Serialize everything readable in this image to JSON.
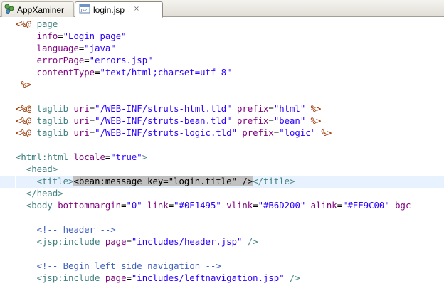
{
  "tabs": [
    {
      "label": "AppXaminer",
      "icon": "project-icon",
      "active": false
    },
    {
      "label": "login.jsp",
      "icon": "jsp-file-icon",
      "active": true,
      "close": "☒"
    }
  ],
  "code": {
    "current_line": 14,
    "lines": [
      [
        [
          "d",
          "<%@ "
        ],
        [
          "k",
          "page"
        ]
      ],
      [
        [
          "p",
          "    "
        ],
        [
          "a",
          "info"
        ],
        [
          "p",
          "="
        ],
        [
          "v",
          "\"Login page\""
        ]
      ],
      [
        [
          "p",
          "    "
        ],
        [
          "a",
          "language"
        ],
        [
          "p",
          "="
        ],
        [
          "v",
          "\"java\""
        ]
      ],
      [
        [
          "p",
          "    "
        ],
        [
          "a",
          "errorPage"
        ],
        [
          "p",
          "="
        ],
        [
          "v",
          "\"errors.jsp\""
        ]
      ],
      [
        [
          "p",
          "    "
        ],
        [
          "a",
          "contentType"
        ],
        [
          "p",
          "="
        ],
        [
          "v",
          "\"text/html;charset=utf-8\""
        ]
      ],
      [
        [
          "p",
          " "
        ],
        [
          "d",
          "%>"
        ]
      ],
      [
        [
          "p",
          ""
        ]
      ],
      [
        [
          "d",
          "<%@ "
        ],
        [
          "k",
          "taglib "
        ],
        [
          "a",
          "uri"
        ],
        [
          "p",
          "="
        ],
        [
          "v",
          "\"/WEB-INF/struts-html.tld\""
        ],
        [
          "p",
          " "
        ],
        [
          "a",
          "prefix"
        ],
        [
          "p",
          "="
        ],
        [
          "v",
          "\"html\""
        ],
        [
          "p",
          " "
        ],
        [
          "d",
          "%>"
        ]
      ],
      [
        [
          "d",
          "<%@ "
        ],
        [
          "k",
          "taglib "
        ],
        [
          "a",
          "uri"
        ],
        [
          "p",
          "="
        ],
        [
          "v",
          "\"/WEB-INF/struts-bean.tld\""
        ],
        [
          "p",
          " "
        ],
        [
          "a",
          "prefix"
        ],
        [
          "p",
          "="
        ],
        [
          "v",
          "\"bean\""
        ],
        [
          "p",
          " "
        ],
        [
          "d",
          "%>"
        ]
      ],
      [
        [
          "d",
          "<%@ "
        ],
        [
          "k",
          "taglib "
        ],
        [
          "a",
          "uri"
        ],
        [
          "p",
          "="
        ],
        [
          "v",
          "\"/WEB-INF/struts-logic.tld\""
        ],
        [
          "p",
          " "
        ],
        [
          "a",
          "prefix"
        ],
        [
          "p",
          "="
        ],
        [
          "v",
          "\"logic\""
        ],
        [
          "p",
          " "
        ],
        [
          "d",
          "%>"
        ]
      ],
      [
        [
          "p",
          ""
        ]
      ],
      [
        [
          "k",
          "<html:html "
        ],
        [
          "a",
          "locale"
        ],
        [
          "p",
          "="
        ],
        [
          "v",
          "\"true\""
        ],
        [
          "k",
          ">"
        ]
      ],
      [
        [
          "p",
          "  "
        ],
        [
          "k",
          "<head>"
        ]
      ],
      [
        [
          "p",
          "    "
        ],
        [
          "k",
          "<title>"
        ],
        [
          "s",
          "<bean:message key=\"login.title\" />"
        ],
        [
          "k",
          "</title>"
        ]
      ],
      [
        [
          "p",
          "  "
        ],
        [
          "k",
          "</head>"
        ]
      ],
      [
        [
          "p",
          "  "
        ],
        [
          "k",
          "<body "
        ],
        [
          "a",
          "bottommargin"
        ],
        [
          "p",
          "="
        ],
        [
          "v",
          "\"0\""
        ],
        [
          "p",
          " "
        ],
        [
          "a",
          "link"
        ],
        [
          "p",
          "="
        ],
        [
          "v",
          "\"#0E1495\""
        ],
        [
          "p",
          " "
        ],
        [
          "a",
          "vlink"
        ],
        [
          "p",
          "="
        ],
        [
          "v",
          "\"#B6D200\""
        ],
        [
          "p",
          " "
        ],
        [
          "a",
          "alink"
        ],
        [
          "p",
          "="
        ],
        [
          "v",
          "\"#EE9C00\""
        ],
        [
          "p",
          " "
        ],
        [
          "a",
          "bgc"
        ]
      ],
      [
        [
          "p",
          ""
        ]
      ],
      [
        [
          "p",
          "    "
        ],
        [
          "c",
          "<!-- header -->"
        ]
      ],
      [
        [
          "p",
          "    "
        ],
        [
          "k",
          "<jsp:include "
        ],
        [
          "a",
          "page"
        ],
        [
          "p",
          "="
        ],
        [
          "v",
          "\"includes/header.jsp\""
        ],
        [
          "p",
          " "
        ],
        [
          "k",
          "/>"
        ]
      ],
      [
        [
          "p",
          ""
        ]
      ],
      [
        [
          "p",
          "    "
        ],
        [
          "c",
          "<!-- Begin left side navigation -->"
        ]
      ],
      [
        [
          "p",
          "    "
        ],
        [
          "k",
          "<jsp:include "
        ],
        [
          "a",
          "page"
        ],
        [
          "p",
          "="
        ],
        [
          "v",
          "\"includes/leftnavigation.jsp\""
        ],
        [
          "p",
          " "
        ],
        [
          "k",
          "/>"
        ]
      ]
    ]
  },
  "colors": {
    "directive": "#993300",
    "tag": "#3f7f7f",
    "attribute": "#7f007f",
    "value": "#2a00ff",
    "comment": "#3f5fbf",
    "selection": "#c0c0c0",
    "current_line": "#e8f2fe"
  }
}
